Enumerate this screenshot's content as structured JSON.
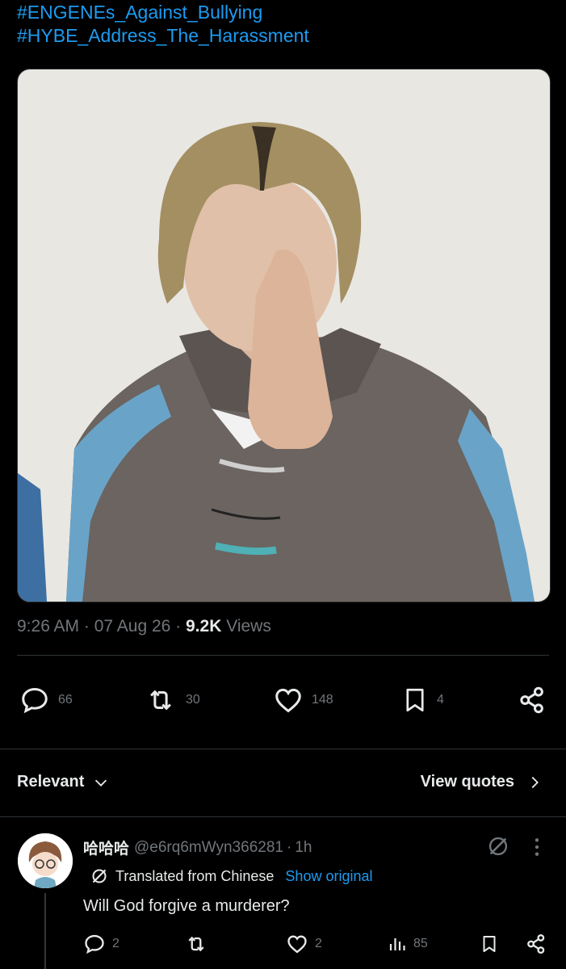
{
  "tweet": {
    "hashtags": [
      "#ENGENEs_Against_Bullying",
      "#HYBE_Address_The_Harassment"
    ],
    "time": "9:26 AM",
    "date": "07 Aug 26",
    "views_count": "9.2K",
    "views_label": "Views",
    "actions": {
      "replies": "66",
      "reposts": "30",
      "likes": "148",
      "bookmarks": "4"
    }
  },
  "replies_header": {
    "sort_label": "Relevant",
    "view_quotes_label": "View quotes"
  },
  "reply": {
    "display_name": "哈哈哈",
    "handle": "@e6rq6mWyn366281",
    "time": "1h",
    "translated_label": "Translated from Chinese",
    "show_original_label": "Show original",
    "text": "Will God forgive a murderer?",
    "actions": {
      "replies": "2",
      "likes": "2",
      "views": "85"
    }
  },
  "icons": {
    "reply": "speech-bubble-icon",
    "repost": "repost-arrows-icon",
    "like": "heart-icon",
    "bookmark": "bookmark-icon",
    "share": "share-icon",
    "views": "bar-chart-icon",
    "grok": "slashed-circle-icon",
    "more": "vertical-dots-icon"
  },
  "colors": {
    "background": "#000000",
    "link": "#1d9bf0",
    "muted": "#71767b",
    "text": "#e7e9ea"
  }
}
